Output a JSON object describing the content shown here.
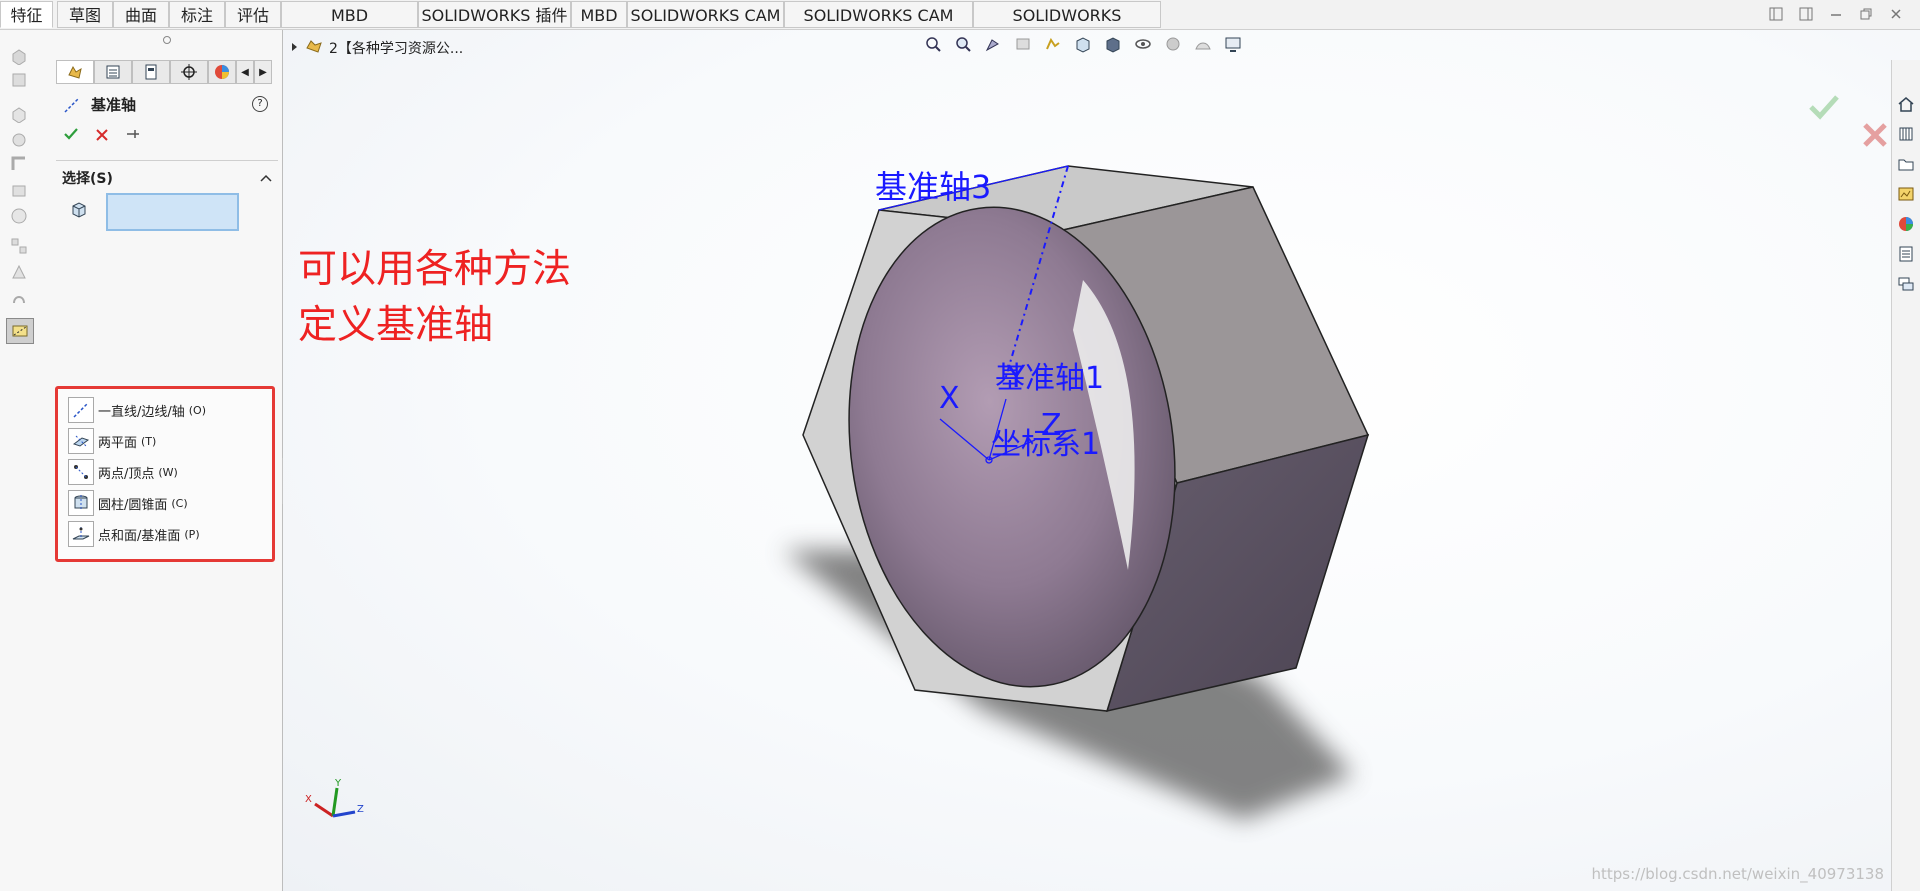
{
  "ribbon": {
    "tabs": [
      {
        "label": "特征",
        "active": true
      },
      {
        "label": "草图"
      },
      {
        "label": "曲面"
      },
      {
        "label": "标注"
      },
      {
        "label": "评估"
      },
      {
        "label": "MBD Dimensions"
      },
      {
        "label": "SOLIDWORKS 插件"
      },
      {
        "label": "MBD"
      },
      {
        "label": "SOLIDWORKS CAM"
      },
      {
        "label": "SOLIDWORKS CAM TBM"
      },
      {
        "label": "SOLIDWORKS Inspection"
      }
    ]
  },
  "property_manager": {
    "title": "基准轴",
    "help_label": "?",
    "selection_section": "选择(S)",
    "methods": [
      {
        "label": "一直线/边线/轴",
        "key": "(O)",
        "icon": "line-edge-axis-icon"
      },
      {
        "label": "两平面",
        "key": "(T)",
        "icon": "two-planes-icon"
      },
      {
        "label": "两点/顶点",
        "key": "(W)",
        "icon": "two-points-icon"
      },
      {
        "label": "圆柱/圆锥面",
        "key": "(C)",
        "icon": "cylinder-cone-icon"
      },
      {
        "label": "点和面/基准面",
        "key": "(P)",
        "icon": "point-and-plane-icon"
      }
    ]
  },
  "viewport": {
    "breadcrumb": "2【各种学习资源公...",
    "annotation_lines": [
      "可以用各种方法",
      "定义基准轴"
    ],
    "labels": {
      "axis3": "基准轴3",
      "axis1": "基准轴1",
      "coord_system": "坐标系1",
      "x": "X",
      "y": "Y",
      "z": "Z"
    },
    "triad": {
      "x": "X",
      "y": "Y",
      "z": "Z"
    },
    "watermark": "https://blog.csdn.net/weixin_40973138"
  },
  "colors": {
    "annotation": "#ee2222",
    "highlight_border": "#e53935",
    "model_labels": "#1a1aff",
    "confirm_green": "#2e9e3c",
    "cancel_red": "#d62b2b"
  }
}
